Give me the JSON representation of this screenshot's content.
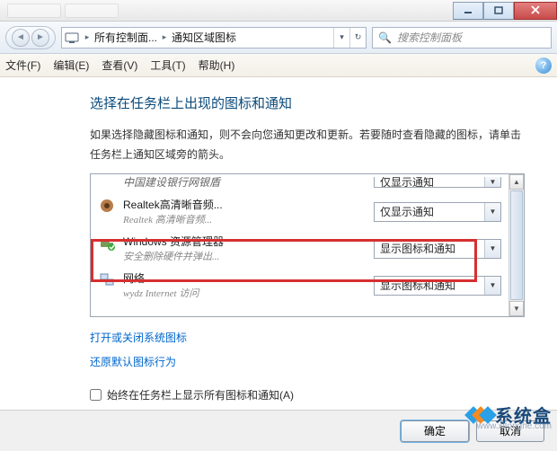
{
  "window": {
    "min": "—",
    "max": "□",
    "close": "×"
  },
  "nav": {
    "breadcrumb1": "所有控制面...",
    "breadcrumb2": "通知区域图标",
    "search_placeholder": "搜索控制面板"
  },
  "menu": {
    "file": "文件(F)",
    "edit": "编辑(E)",
    "view": "查看(V)",
    "tools": "工具(T)",
    "help": "帮助(H)"
  },
  "page": {
    "heading": "选择在任务栏上出现的图标和通知",
    "desc": "如果选择隐藏图标和通知，则不会向您通知更改和更新。若要随时查看隐藏的图标，请单击任务栏上通知区域旁的箭头。"
  },
  "rows": [
    {
      "title": "中国建设银行网银盾",
      "sub": "",
      "combo": "仅显示通知",
      "icon": "ccb"
    },
    {
      "title": "Realtek高清晰音频...",
      "sub": "Realtek 高清晰音频...",
      "combo": "仅显示通知",
      "icon": "speaker"
    },
    {
      "title": "Windows 资源管理器",
      "sub": "安全删除硬件并弹出...",
      "combo": "显示图标和通知",
      "icon": "usb"
    },
    {
      "title": "网络",
      "sub": "wydz Internet 访问",
      "combo": "显示图标和通知",
      "icon": "network"
    }
  ],
  "links": {
    "toggle_system": "打开或关闭系统图标",
    "restore_defaults": "还原默认图标行为"
  },
  "checkbox": {
    "label": "始终在任务栏上显示所有图标和通知(A)"
  },
  "buttons": {
    "ok": "确定",
    "cancel": "取消"
  },
  "watermark": {
    "text": "系统盒",
    "url": "www.xitonghe.com"
  }
}
